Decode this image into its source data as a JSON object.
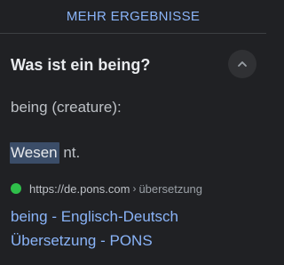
{
  "more_results": {
    "label": "MEHR ERGEBNISSE"
  },
  "question": {
    "text": "Was ist ein being?",
    "toggle_icon": "chevron-up-icon",
    "expanded": true
  },
  "answer": {
    "heading": "being (creature):",
    "highlighted_term": "Wesen",
    "term_suffix": " nt."
  },
  "source": {
    "favicon_icon": "pons-favicon-icon",
    "favicon_color": "#2fbf4a",
    "url": "https://de.pons.com",
    "separator": "›",
    "path": "übersetzung"
  },
  "result": {
    "title": "being - Englisch-Deutsch Übersetzung - PONS"
  },
  "colors": {
    "background": "#202124",
    "link": "#8ab4f8",
    "primary_text": "#e8eaed",
    "secondary_text": "#bdc1c6",
    "highlight": "#3b4d68"
  }
}
